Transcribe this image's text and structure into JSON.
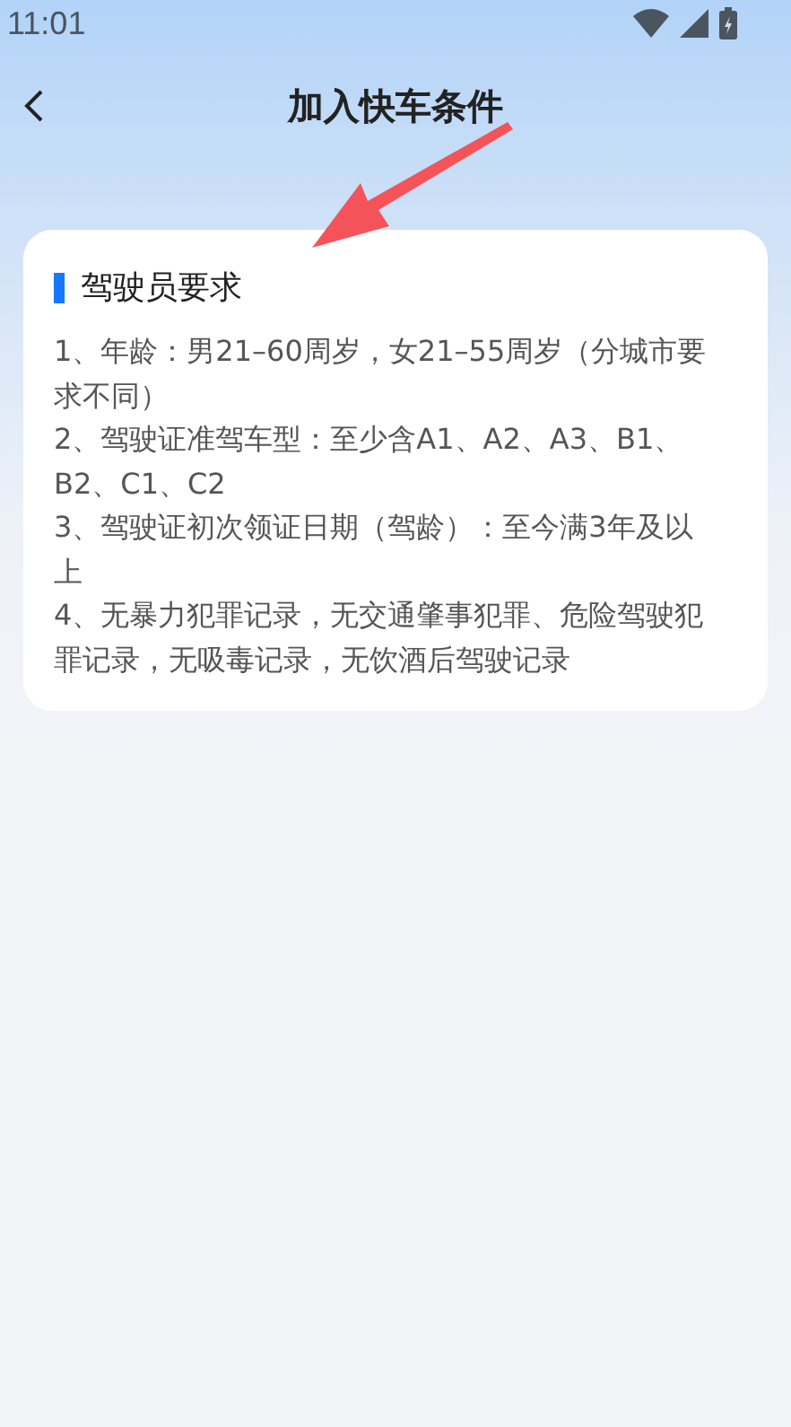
{
  "status_bar": {
    "time": "11:01"
  },
  "header": {
    "title": "加入快车条件"
  },
  "annotations": [
    {
      "kind": "arrow",
      "color": "#f5535a"
    }
  ],
  "card": {
    "heading": "驾驶员要求",
    "items": [
      "1、年龄：男21–60周岁，女21–55周岁（分城市要求不同）",
      "2、驾驶证准驾车型：至少含A1、A2、A3、B1、B2、C1、C2",
      "3、驾驶证初次领证日期（驾龄）：至今满3年及以上",
      "4、无暴力犯罪记录，无交通肇事犯罪、危险驾驶犯罪记录，无吸毒记录，无饮酒后驾驶记录"
    ]
  }
}
